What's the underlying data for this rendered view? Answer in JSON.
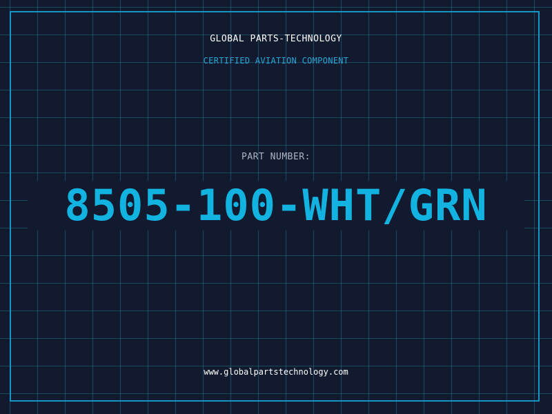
{
  "header": {
    "brand": "GLOBAL PARTS-TECHNOLOGY",
    "tagline": "CERTIFIED AVIATION COMPONENT"
  },
  "part": {
    "label": "PART NUMBER:",
    "number": "8505-100-WHT/GRN"
  },
  "footer": {
    "website": "www.globalpartstechnology.com"
  },
  "colors": {
    "background": "#111a2e",
    "accent": "#12b3e0",
    "grid": "#266e8c",
    "frame": "#1596c4"
  }
}
